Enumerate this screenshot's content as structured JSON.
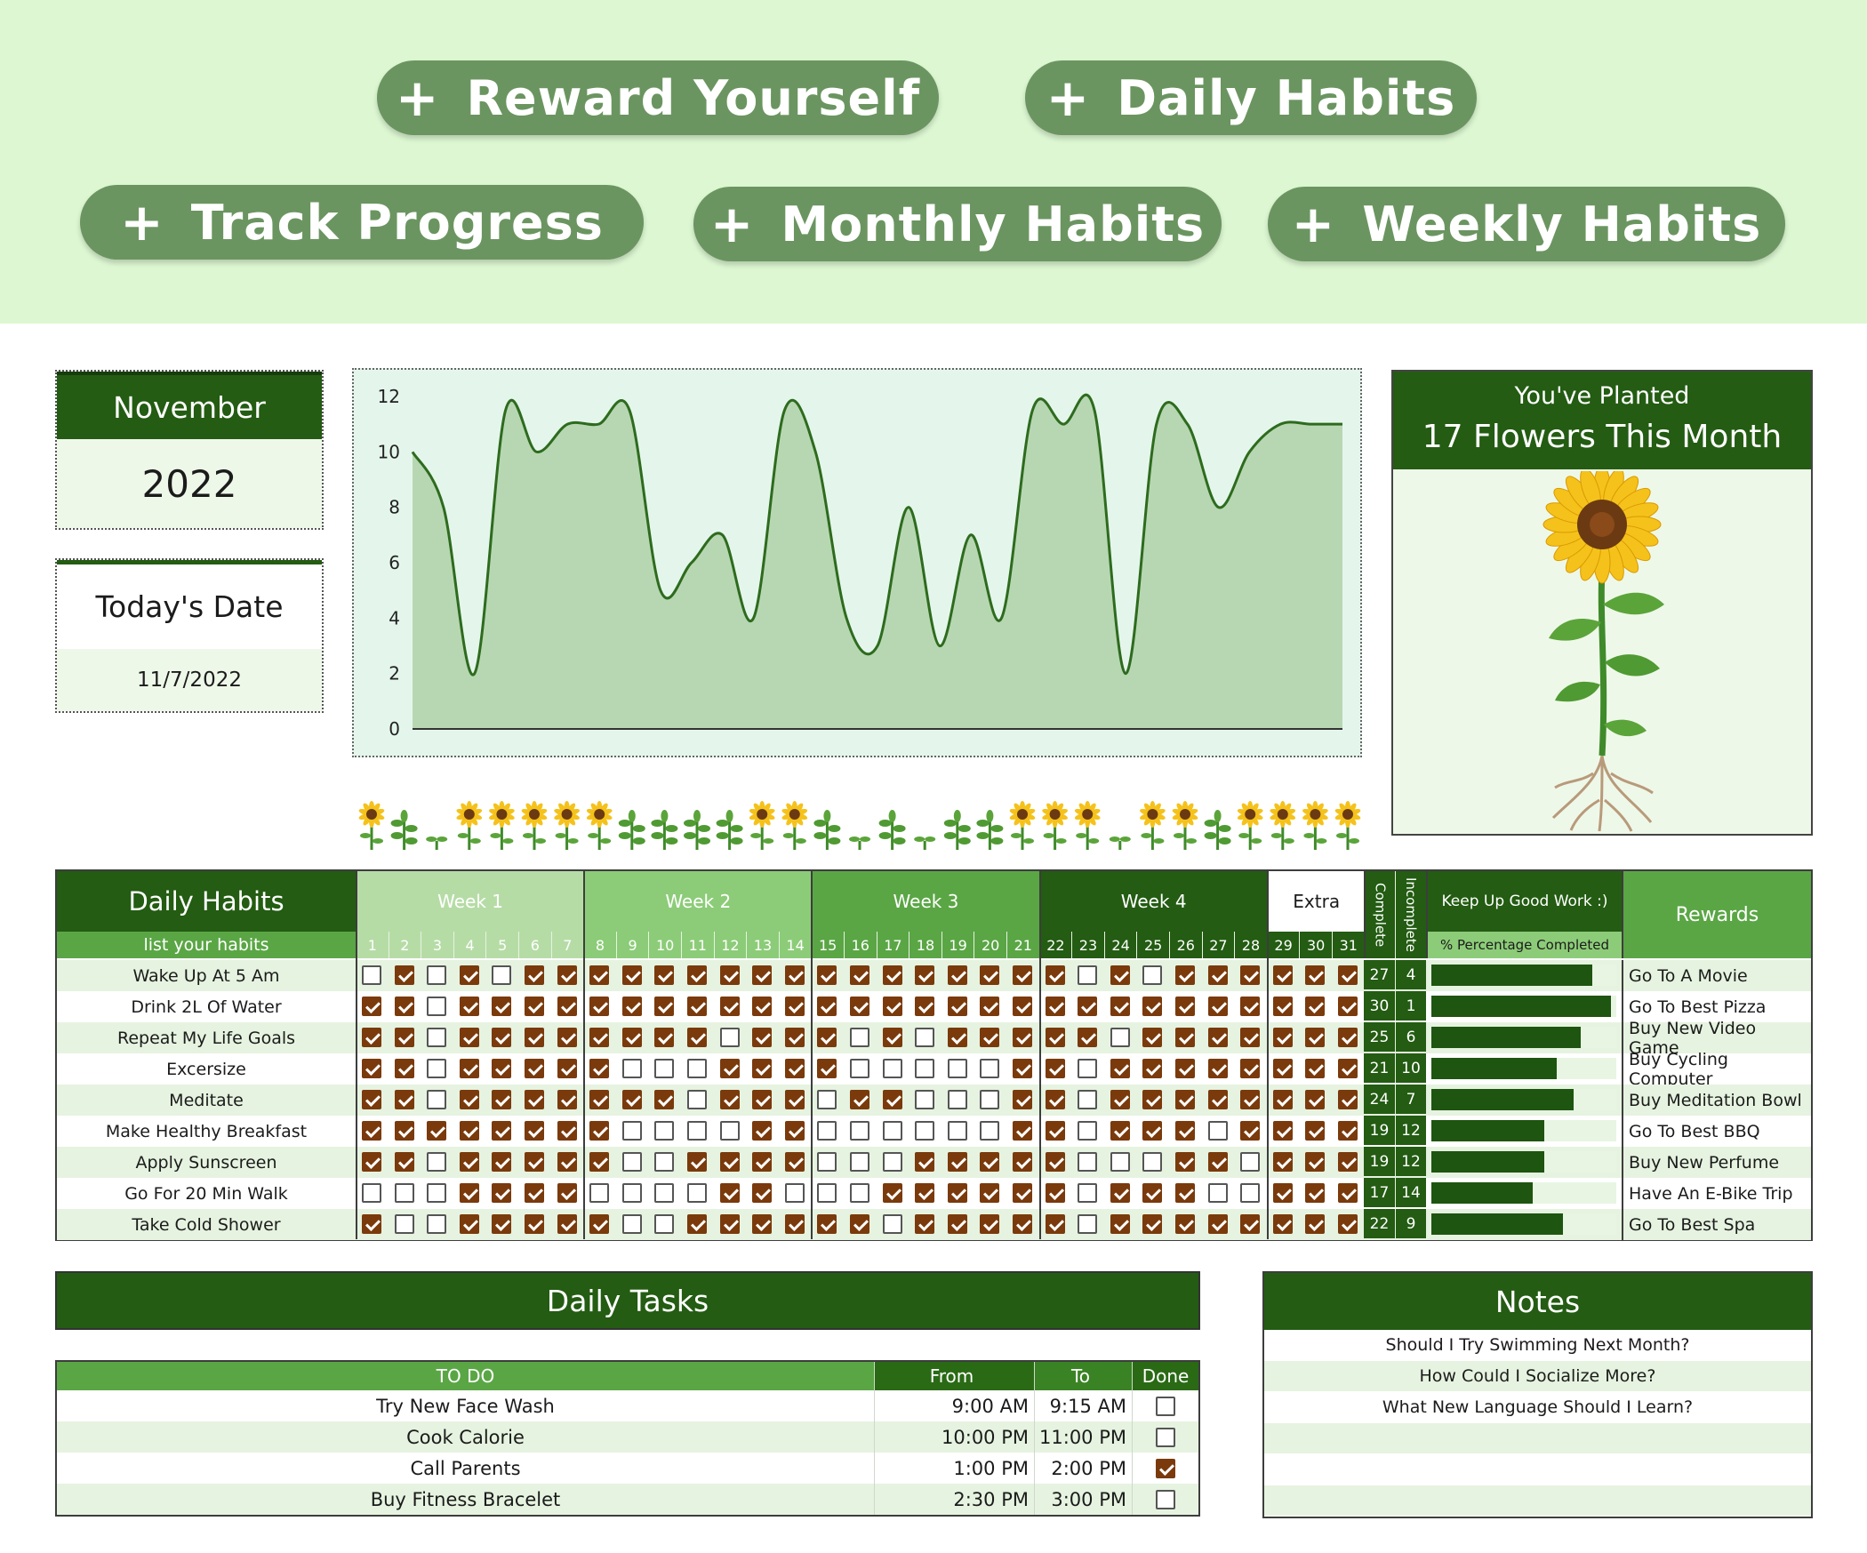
{
  "buttons": {
    "reward": "Reward Yourself",
    "daily": "Daily Habits",
    "track": "Track Progress",
    "monthly": "Monthly Habits",
    "weekly": "Weekly Habits",
    "plus": "+"
  },
  "date": {
    "month": "November",
    "year": "2022",
    "today_label": "Today's Date",
    "today_value": "11/7/2022"
  },
  "chart_data": {
    "type": "area",
    "x": [
      1,
      2,
      3,
      4,
      5,
      6,
      7,
      8,
      9,
      10,
      11,
      12,
      13,
      14,
      15,
      16,
      17,
      18,
      19,
      20,
      21,
      22,
      23,
      24,
      25,
      26,
      27,
      28,
      29,
      30,
      31
    ],
    "values": [
      10,
      8,
      2,
      11.5,
      10,
      11,
      11,
      11.5,
      5,
      6,
      7,
      4,
      11.5,
      10,
      4,
      3,
      8,
      3,
      7,
      4,
      11.5,
      11,
      11.5,
      2,
      11,
      11,
      8,
      10,
      11,
      11,
      11
    ],
    "ylim": [
      0,
      12
    ],
    "yticks": [
      "0",
      "2",
      "4",
      "6",
      "8",
      "10",
      "12"
    ],
    "colors": {
      "line": "#2e6b1e",
      "fill": "#b7d7b2"
    }
  },
  "planted": {
    "line1": "You've Planted",
    "line2": "17 Flowers This Month"
  },
  "flowers": "sunflower,sprout,seedling,sunflower,sunflower,sunflower,sunflower,sunflower,sprout,sprout,sprout,sprout,sunflower,sunflower,sprout,seedling,sprout,seedling,sprout,sprout,sunflower,sunflower,sunflower,seedling,sunflower,sunflower,sprout,sunflower,sunflower,sunflower,sunflower",
  "habits": {
    "title": "Daily Habits",
    "subtitle": "list your habits",
    "weeks": [
      "Week 1",
      "Week 2",
      "Week 3",
      "Week 4",
      "Extra"
    ],
    "days": [
      "1",
      "2",
      "3",
      "4",
      "5",
      "6",
      "7",
      "8",
      "9",
      "10",
      "11",
      "12",
      "13",
      "14",
      "15",
      "16",
      "17",
      "18",
      "19",
      "20",
      "21",
      "22",
      "23",
      "24",
      "25",
      "26",
      "27",
      "28",
      "29",
      "30",
      "31"
    ],
    "complete_label": "Complete",
    "incomplete_label": "Incomplete",
    "keep_label": "Keep Up Good Work :)",
    "pct_label": "% Percentage Completed",
    "rewards_label": "Rewards",
    "rows": [
      {
        "name": "Wake Up At 5 Am",
        "checks": "0101011111111111111111010111111",
        "complete": "27",
        "incomplete": "4",
        "pct": 87,
        "reward": "Go To A Movie"
      },
      {
        "name": "Drink 2L Of Water",
        "checks": "1101111111111111111111111111111",
        "complete": "30",
        "incomplete": "1",
        "pct": 97,
        "reward": "Go To Best Pizza"
      },
      {
        "name": "Repeat My Life Goals",
        "checks": "1101111111101110101111101111111",
        "complete": "25",
        "incomplete": "6",
        "pct": 81,
        "reward": "Buy New Video Game"
      },
      {
        "name": "Excersize",
        "checks": "1101111100011110000011011111111",
        "complete": "21",
        "incomplete": "10",
        "pct": 68,
        "reward": "Buy Cycling Computer"
      },
      {
        "name": "Meditate",
        "checks": "1101111111011101100011011111111",
        "complete": "24",
        "incomplete": "7",
        "pct": 77,
        "reward": "Buy Meditation Bowl"
      },
      {
        "name": "Make Healthy Breakfast",
        "checks": "1111111100001100000011011101111",
        "complete": "19",
        "incomplete": "12",
        "pct": 61,
        "reward": "Go To Best BBQ"
      },
      {
        "name": "Apply Sunscreen",
        "checks": "1101111100111100011111000110111",
        "complete": "19",
        "incomplete": "12",
        "pct": 61,
        "reward": "Buy New Perfume"
      },
      {
        "name": "Go For 20 Min Walk",
        "checks": "0001111000011000111111011100111",
        "complete": "17",
        "incomplete": "14",
        "pct": 55,
        "reward": "Have An E-Bike Trip"
      },
      {
        "name": "Take Cold Shower",
        "checks": "1001111100111111011111011111111",
        "complete": "22",
        "incomplete": "9",
        "pct": 71,
        "reward": "Go To Best Spa"
      }
    ]
  },
  "tasks": {
    "title": "Daily Tasks",
    "headers": {
      "todo": "TO DO",
      "from": "From",
      "to": "To",
      "done": "Done"
    },
    "rows": [
      {
        "todo": "Try New Face Wash",
        "from": "9:00 AM",
        "to": "9:15 AM",
        "done": false
      },
      {
        "todo": "Cook Calorie",
        "from": "10:00 PM",
        "to": "11:00 PM",
        "done": false
      },
      {
        "todo": "Call Parents",
        "from": "1:00 PM",
        "to": "2:00 PM",
        "done": true
      },
      {
        "todo": "Buy Fitness Bracelet",
        "from": "2:30 PM",
        "to": "3:00 PM",
        "done": false
      }
    ]
  },
  "notes": {
    "title": "Notes",
    "items": [
      "Should I Try Swimming Next Month?",
      "How Could I Socialize More?",
      "What New Language Should I Learn?",
      "",
      "",
      ""
    ]
  }
}
